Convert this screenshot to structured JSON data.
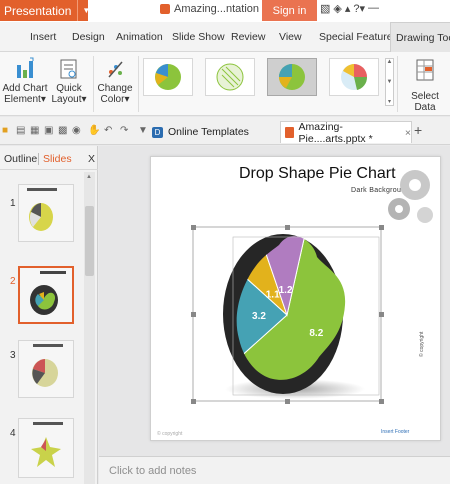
{
  "titlebar": {
    "app_menu": "Presentation",
    "doc_title": "Amazing...ntation",
    "signin": "Sign in",
    "icons": [
      "shirt-icon",
      "skin-icon",
      "shirt-icon",
      "help-icon",
      "minimize-icon"
    ]
  },
  "ribbon_tabs": [
    "Insert",
    "Design",
    "Animation",
    "Slide Show",
    "Review",
    "View",
    "Special Features",
    "Drawing Tools"
  ],
  "ribbon": {
    "add_chart_1": "Add Chart",
    "add_chart_2": "Element",
    "quick_1": "Quick",
    "quick_2": "Layout",
    "change_1": "Change",
    "change_2": "Color",
    "select_data": "Select Data",
    "style_gallery": [
      "pie-style-1",
      "pie-style-2",
      "pie-style-3",
      "pie-style-4"
    ]
  },
  "toolbar": {
    "online_templates": "Online Templates",
    "doc_tab": "Amazing-Pie....arts.pptx *",
    "doc_close": "×",
    "new_tab": "+"
  },
  "left_panel": {
    "tab_outline": "Outline",
    "tab_slides": "Slides",
    "close": "X",
    "slide_numbers": [
      "1",
      "2",
      "3",
      "4"
    ]
  },
  "slide": {
    "title": "Drop Shape Pie Chart",
    "subtitle": "Dark Background",
    "side_text": "© copyright",
    "footer_left": "© copyright",
    "footer_right": "Insert Footer"
  },
  "notes_placeholder": "Click to add notes",
  "chart_data": {
    "type": "pie",
    "categories": [
      "8.2",
      "3.2",
      "1.1",
      "1.2"
    ],
    "values": [
      8.2,
      3.2,
      1.1,
      1.2
    ],
    "title": "",
    "colors": [
      "#8cc43c",
      "#45a2b4",
      "#e2b21c",
      "#b07cc0"
    ]
  },
  "colors": {
    "accent": "#e2602c",
    "signin": "#ea7350",
    "link_blue": "#1f6fc0"
  }
}
